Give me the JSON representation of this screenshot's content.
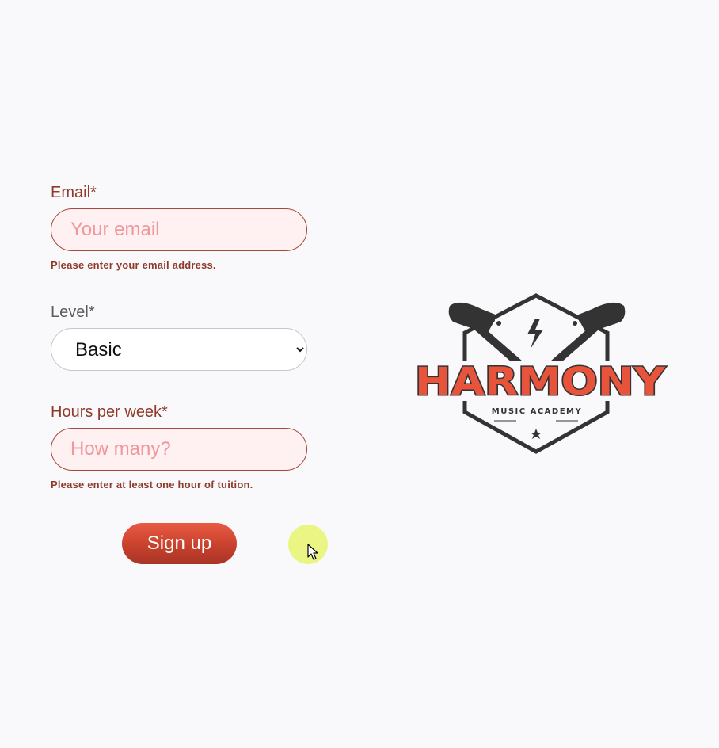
{
  "form": {
    "email": {
      "label": "Email*",
      "placeholder": "Your email",
      "error": "Please enter your email address."
    },
    "level": {
      "label": "Level*",
      "selected": "Basic"
    },
    "hours": {
      "label": "Hours per week*",
      "placeholder": "How many?",
      "error": "Please enter at least one hour of tuition."
    },
    "submit_label": "Sign up"
  },
  "logo": {
    "brand": "HARMONY",
    "tagline": "MUSIC ACADEMY"
  },
  "colors": {
    "accent": "#e8533b",
    "error": "#8f3a2a",
    "field_error_bg": "#fff0f1",
    "logo_dark": "#333333"
  },
  "icons": {
    "cursor": "pointer-cursor-icon",
    "select": "chevron-down-icon"
  }
}
